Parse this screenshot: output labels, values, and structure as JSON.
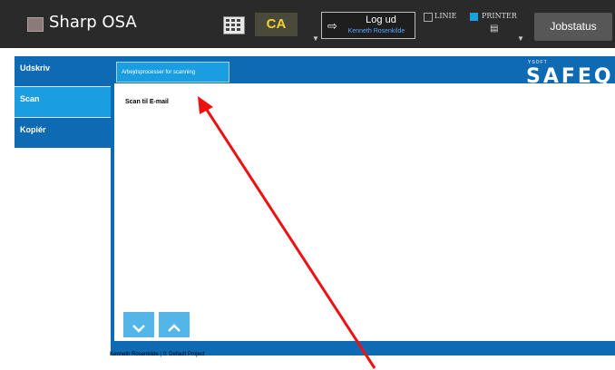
{
  "header": {
    "app_title": "Sharp OSA",
    "keypad_icon": "keypad-icon",
    "ca_label": "CA",
    "logout_label": "Log ud",
    "logout_user": "Kenneth Rosenkilde",
    "linie_label": "LINIE",
    "printer_label": "PRINTER",
    "jobstatus_label": "Jobstatus"
  },
  "sidebar": {
    "items": [
      {
        "label": "Udskriv",
        "active": false
      },
      {
        "label": "Scan",
        "active": true
      },
      {
        "label": "Kopiér",
        "active": false
      }
    ]
  },
  "panel": {
    "tab_label": "Arbejdsprocesser for scanning",
    "brand_small": "YSOFT",
    "brand_large": "SAFEQ",
    "workflows": [
      "Scan til E-mail"
    ],
    "nav_down_icon": "chevron-down-icon",
    "nav_up_icon": "chevron-up-icon"
  },
  "footer": {
    "status_text": "Kenneth Rosenkilde  | 0: Default Project"
  },
  "colors": {
    "topbar": "#2a2a2a",
    "sidebar": "#0f6ab4",
    "sidebar_active": "#1b9de2",
    "ca_text": "#f0d230",
    "printer_indicator": "#1a9fe0",
    "annotation_arrow": "#ee1111"
  }
}
